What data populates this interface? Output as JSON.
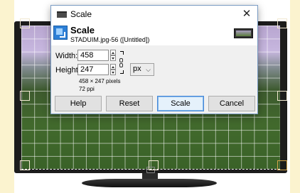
{
  "dialog": {
    "window_title": "Scale",
    "close_glyph": "✕",
    "header_title": "Scale",
    "header_subtitle": "STADUIM.jpg-56 ([Untitled])",
    "width_label": "Width:",
    "height_label": "Height:",
    "width_value": "458",
    "height_value": "247",
    "unit_value": "px",
    "unit_chevron": "⌵",
    "size_info": "458 × 247 pixels",
    "resolution_info": "72 ppi",
    "buttons": {
      "help": "Help",
      "reset": "Reset",
      "scale": "Scale",
      "cancel": "Cancel"
    }
  },
  "icons": {
    "window_icon": "window-icon",
    "scale_icon": "scale-image-icon",
    "chain_icon": "chain-link-icon",
    "thumbnail": "image-thumbnail"
  },
  "colors": {
    "dialog_border": "#7a9cc4",
    "default_button_border": "#4a8ad8",
    "canvas_side_strip": "#fbf3cf"
  }
}
